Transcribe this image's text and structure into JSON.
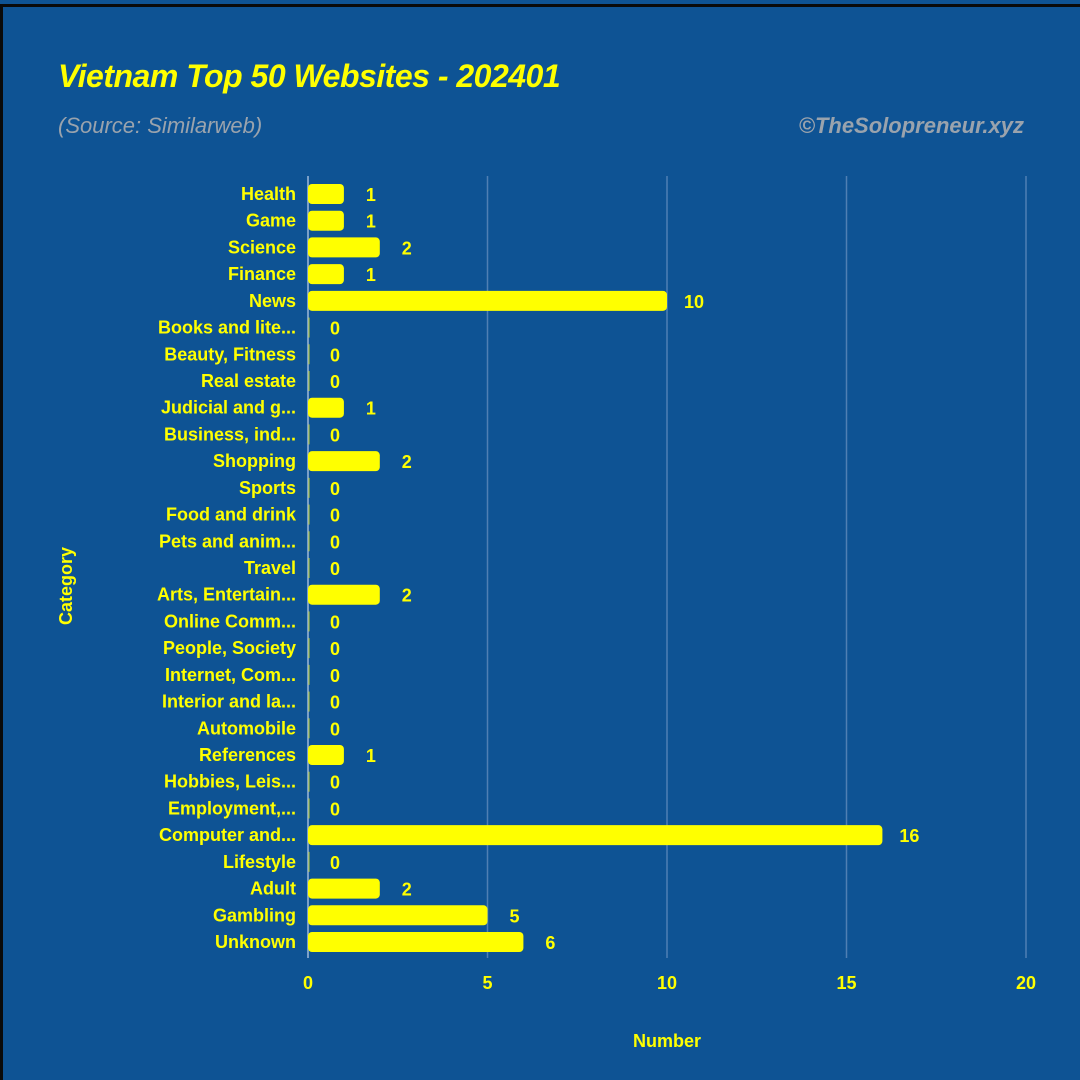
{
  "header": {
    "title": "Vietnam Top 50 Websites - 202401",
    "subtitle": "(Source: Similarweb)",
    "credit": "©TheSolopreneur.xyz"
  },
  "colors": {
    "background": "#0e5394",
    "bar": "#ffff00",
    "text": "#ffff00",
    "muted_text": "#9aa3ad",
    "gridline": "#4f7fb3"
  },
  "chart_data": {
    "type": "bar",
    "orientation": "horizontal",
    "title": "Vietnam Top 50 Websites - 202401",
    "subtitle": "(Source: Similarweb)",
    "xlabel": "Number",
    "ylabel": "Category",
    "xlim": [
      0,
      20
    ],
    "xticks": [
      0,
      5,
      10,
      15,
      20
    ],
    "grid": "vertical",
    "categories": [
      "Health",
      "Game",
      "Science",
      "Finance",
      "News",
      "Books and lite...",
      "Beauty, Fitness",
      "Real estate",
      "Judicial and g...",
      "Business, ind...",
      "Shopping",
      "Sports",
      "Food and drink",
      "Pets and anim...",
      "Travel",
      "Arts, Entertain...",
      "Online Comm...",
      "People, Society",
      "Internet, Com...",
      "Interior and la...",
      "Automobile",
      "References",
      "Hobbies, Leis...",
      "Employment,...",
      "Computer and...",
      "Lifestyle",
      "Adult",
      "Gambling",
      "Unknown"
    ],
    "values": [
      1,
      1,
      2,
      1,
      10,
      0,
      0,
      0,
      1,
      0,
      2,
      0,
      0,
      0,
      0,
      2,
      0,
      0,
      0,
      0,
      0,
      1,
      0,
      0,
      16,
      0,
      2,
      5,
      6
    ]
  }
}
